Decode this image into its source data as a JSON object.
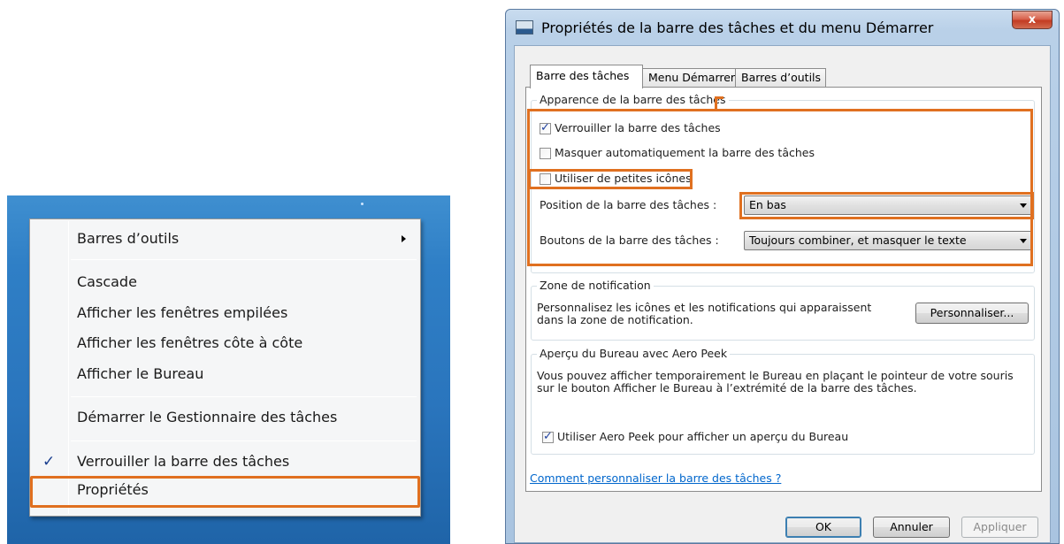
{
  "context_menu": {
    "items": [
      {
        "label": "Barres d’outils"
      },
      {
        "label": "Cascade"
      },
      {
        "label": "Afficher les fenêtres empilées"
      },
      {
        "label": "Afficher les fenêtres côte à côte"
      },
      {
        "label": "Afficher le Bureau"
      },
      {
        "label": "Démarrer le Gestionnaire des tâches"
      },
      {
        "label": "Verrouiller la barre des tâches"
      },
      {
        "label": "Propriétés"
      }
    ],
    "checkmark": "✓"
  },
  "dialog": {
    "title": "Propriétés de la barre des tâches et du menu Démarrer",
    "close_label": "x",
    "tabs": [
      {
        "label": "Barre des tâches"
      },
      {
        "label": "Menu Démarrer"
      },
      {
        "label": "Barres d’outils"
      }
    ],
    "appearance": {
      "legend": "Apparence de la barre des tâches",
      "lock_label": "Verrouiller la barre des tâches",
      "lock_checked": true,
      "autohide_label": "Masquer automatiquement la barre des tâches",
      "autohide_checked": false,
      "small_icons_label": "Utiliser de petites icônes",
      "small_icons_checked": false,
      "position_label": "Position de la barre des tâches :",
      "position_value": "En bas",
      "buttons_label": "Boutons de la barre des tâches :",
      "buttons_value": "Toujours combiner, et masquer le texte"
    },
    "notification": {
      "legend": "Zone de notification",
      "text_line1": "Personnalisez les icônes et les notifications qui apparaissent",
      "text_line2": "dans la zone de notification.",
      "customize_button": "Personnaliser..."
    },
    "aero_peek": {
      "legend": "Aperçu du Bureau avec Aero Peek",
      "text_line1": "Vous pouvez afficher temporairement le Bureau en plaçant le pointeur de votre souris",
      "text_line2": "sur le bouton Afficher le Bureau à l’extrémité de la barre des tâches.",
      "use_label": "Utiliser Aero Peek pour afficher un aperçu du Bureau",
      "use_checked": true
    },
    "help_link": "Comment personnaliser la barre des tâches ?",
    "buttons": {
      "ok": "OK",
      "cancel": "Annuler",
      "apply": "Appliquer"
    },
    "highlight_color": "#e07020"
  }
}
